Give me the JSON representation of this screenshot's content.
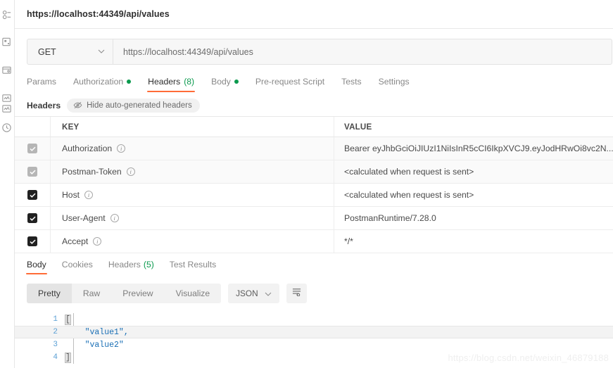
{
  "sidebar": {
    "items": [
      {
        "name": "collections-icon",
        "label": "Collections"
      },
      {
        "name": "apis-icon",
        "label": "APIs"
      },
      {
        "name": "environments-icon",
        "label": "Environments"
      },
      {
        "name": "mock-servers-icon",
        "label": "Mock Servers"
      },
      {
        "name": "monitors-icon",
        "label": "Monitors"
      },
      {
        "name": "history-icon",
        "label": "History"
      }
    ]
  },
  "request": {
    "title": "https://localhost:44349/api/values",
    "method": "GET",
    "url": "https://localhost:44349/api/values",
    "tabs": [
      {
        "label": "Params",
        "dot": false,
        "count": "",
        "active": false
      },
      {
        "label": "Authorization",
        "dot": true,
        "count": "",
        "active": false
      },
      {
        "label": "Headers",
        "dot": false,
        "count": "(8)",
        "active": true
      },
      {
        "label": "Body",
        "dot": true,
        "count": "",
        "active": false
      },
      {
        "label": "Pre-request Script",
        "dot": false,
        "count": "",
        "active": false
      },
      {
        "label": "Tests",
        "dot": false,
        "count": "",
        "active": false
      },
      {
        "label": "Settings",
        "dot": false,
        "count": "",
        "active": false
      }
    ]
  },
  "headers_panel": {
    "section_label": "Headers",
    "toggle_label": "Hide auto-generated headers",
    "columns": {
      "key": "KEY",
      "value": "VALUE"
    },
    "rows": [
      {
        "checked": "dim",
        "key": "Authorization",
        "value": "Bearer eyJhbGciOiJIUzI1NiIsInR5cCI6IkpXVCJ9.eyJodHRwOi8vc2N..."
      },
      {
        "checked": "dim",
        "key": "Postman-Token",
        "value": "<calculated when request is sent>"
      },
      {
        "checked": "on",
        "key": "Host",
        "value": "<calculated when request is sent>"
      },
      {
        "checked": "on",
        "key": "User-Agent",
        "value": "PostmanRuntime/7.28.0"
      },
      {
        "checked": "on",
        "key": "Accept",
        "value": "*/*"
      }
    ]
  },
  "response": {
    "tabs": [
      {
        "label": "Body",
        "count": "",
        "active": true
      },
      {
        "label": "Cookies",
        "count": "",
        "active": false
      },
      {
        "label": "Headers",
        "count": "(5)",
        "active": false
      },
      {
        "label": "Test Results",
        "count": "",
        "active": false
      }
    ],
    "view_modes": [
      {
        "label": "Pretty",
        "active": true
      },
      {
        "label": "Raw",
        "active": false
      },
      {
        "label": "Preview",
        "active": false
      },
      {
        "label": "Visualize",
        "active": false
      }
    ],
    "format": "JSON",
    "body_lines": [
      {
        "num": "1",
        "text": "[",
        "bracket": true,
        "highlight": false
      },
      {
        "num": "2",
        "text": "    \"value1\",",
        "bracket": false,
        "highlight": true
      },
      {
        "num": "3",
        "text": "    \"value2\"",
        "bracket": false,
        "highlight": false
      },
      {
        "num": "4",
        "text": "]",
        "bracket": true,
        "highlight": false
      }
    ]
  },
  "watermark": "https://blog.csdn.net/weixin_46879188",
  "colors": {
    "accent": "#ff6c37",
    "green": "#0b9a4e",
    "code_blue": "#1a6fb5",
    "linenum_blue": "#5a9fd4"
  }
}
